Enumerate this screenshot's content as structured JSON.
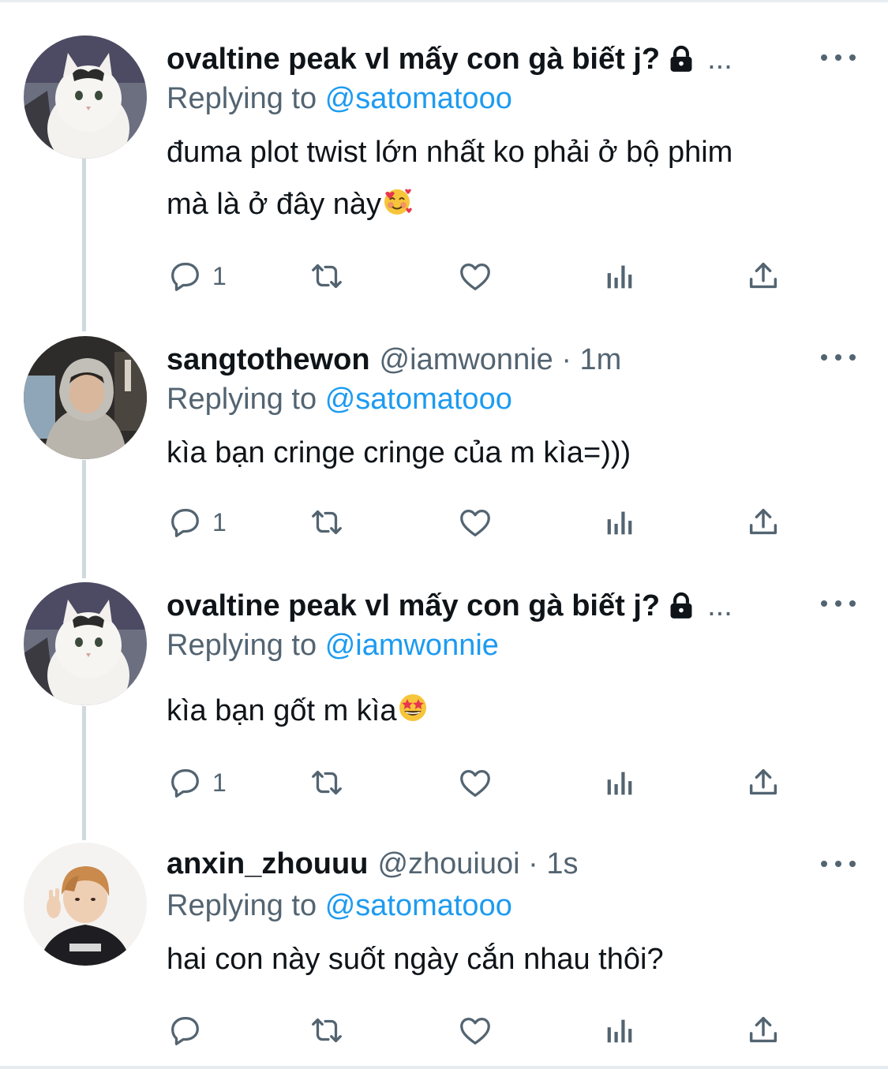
{
  "tweets": [
    {
      "name": "ovaltine peak vl mấy con gà biết j?",
      "handle_time": "",
      "truncated": "...",
      "locked": true,
      "replying_prefix": "Replying to",
      "replying_to": "@satomatooo",
      "text_lines": [
        "đuma plot twist lớn nhất ko phải ở bộ phim",
        "mà là ở đây này"
      ],
      "emoji": "smiling-face-with-hearts",
      "reply_count": "1"
    },
    {
      "name": "sangtothewon",
      "handle_time": "@iamwonnie · 1m",
      "truncated": "",
      "locked": false,
      "replying_prefix": "Replying to",
      "replying_to": "@satomatooo",
      "text_lines": [
        "kìa bạn cringe cringe của m kìa=)))"
      ],
      "emoji": "",
      "reply_count": "1"
    },
    {
      "name": "ovaltine peak vl mấy con gà biết j?",
      "handle_time": "",
      "truncated": "...",
      "locked": true,
      "replying_prefix": "Replying to",
      "replying_to": "@iamwonnie",
      "text_lines": [
        "kìa bạn gốt m kìa"
      ],
      "emoji": "star-struck",
      "reply_count": "1"
    },
    {
      "name": "anxin_zhouuu",
      "handle_time": "@zhouiuoi · 1s",
      "truncated": "",
      "locked": false,
      "replying_prefix": "Replying to",
      "replying_to": "@satomatooo",
      "text_lines": [
        "hai con này suốt ngày cắn nhau thôi?"
      ],
      "emoji": "",
      "reply_count": ""
    }
  ],
  "icons": {
    "reply": "speech-bubble-icon",
    "retweet": "retweet-icon",
    "like": "heart-icon",
    "views": "bar-chart-icon",
    "share": "share-upload-icon",
    "lock": "lock-icon",
    "more": "more-dots-icon"
  },
  "colors": {
    "text": "#0f1419",
    "secondary": "#536471",
    "link": "#1d9bf0",
    "thread_line": "#cfd9de"
  }
}
